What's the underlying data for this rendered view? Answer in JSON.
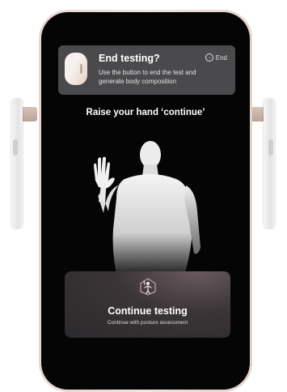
{
  "notification": {
    "title": "End testing?",
    "description": "Use the button to end the test and generate body composition",
    "end_label": "End",
    "end_icon": "exit-icon"
  },
  "prompt": "Raise your hand ‘continue’",
  "action": {
    "label": "Continue testing",
    "sublabel": "Continue with posture assessment",
    "icon": "raise-hand-person-icon"
  },
  "colors": {
    "screen": "#050505",
    "card": "#4a4a4c",
    "frame": "#f0e2dc"
  }
}
